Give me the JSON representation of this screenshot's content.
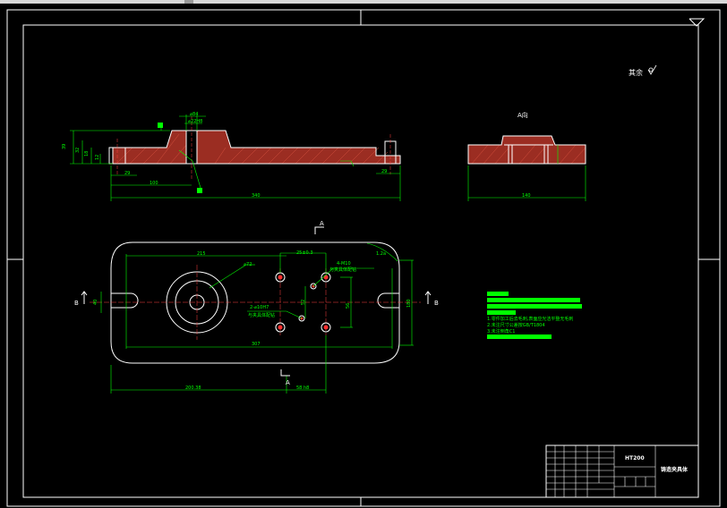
{
  "colors": {
    "background": "#000000",
    "outline": "#ffffff",
    "dimension": "#00ff00",
    "hatch": "#c0392b",
    "hole": "#ff3030",
    "centerline": "#ff4040"
  },
  "corner_mark": "其余",
  "front_view": {
    "dims": {
      "phi84": "⌀84",
      "phi22": "⌀22H8",
      "h39": "39",
      "h32": "32",
      "h18": "18",
      "h12": "12",
      "w29_left": "29",
      "w29_right": "29",
      "w100": "100",
      "total": "340"
    }
  },
  "side_view": {
    "label": "A向",
    "width": "140"
  },
  "top_view": {
    "dims": {
      "d215": "215",
      "phi72": "⌀72",
      "d25": "25±0.3",
      "holes4": "4-M10",
      "holes4_note": "与夹具体配钻",
      "holes2": "2-⌀10H7",
      "holes2_note": "与夹具体配钻",
      "d52": "52",
      "d56": "56",
      "d180": "180",
      "d307": "307",
      "d200": "200.38",
      "d58": "58 h8",
      "d40": "40"
    },
    "section_marks": {
      "A": "A",
      "B": "B"
    },
    "arc_note": "1.2a"
  },
  "notes": {
    "lines": [
      "1.零件加工后去毛刺,表面应光洁平整无毛刺",
      "2.未注尺寸公差按GB/T1804",
      "3.未注倒角C1"
    ]
  },
  "title_block": {
    "drawing_no": "HT200",
    "name": "铸造夹具体"
  }
}
